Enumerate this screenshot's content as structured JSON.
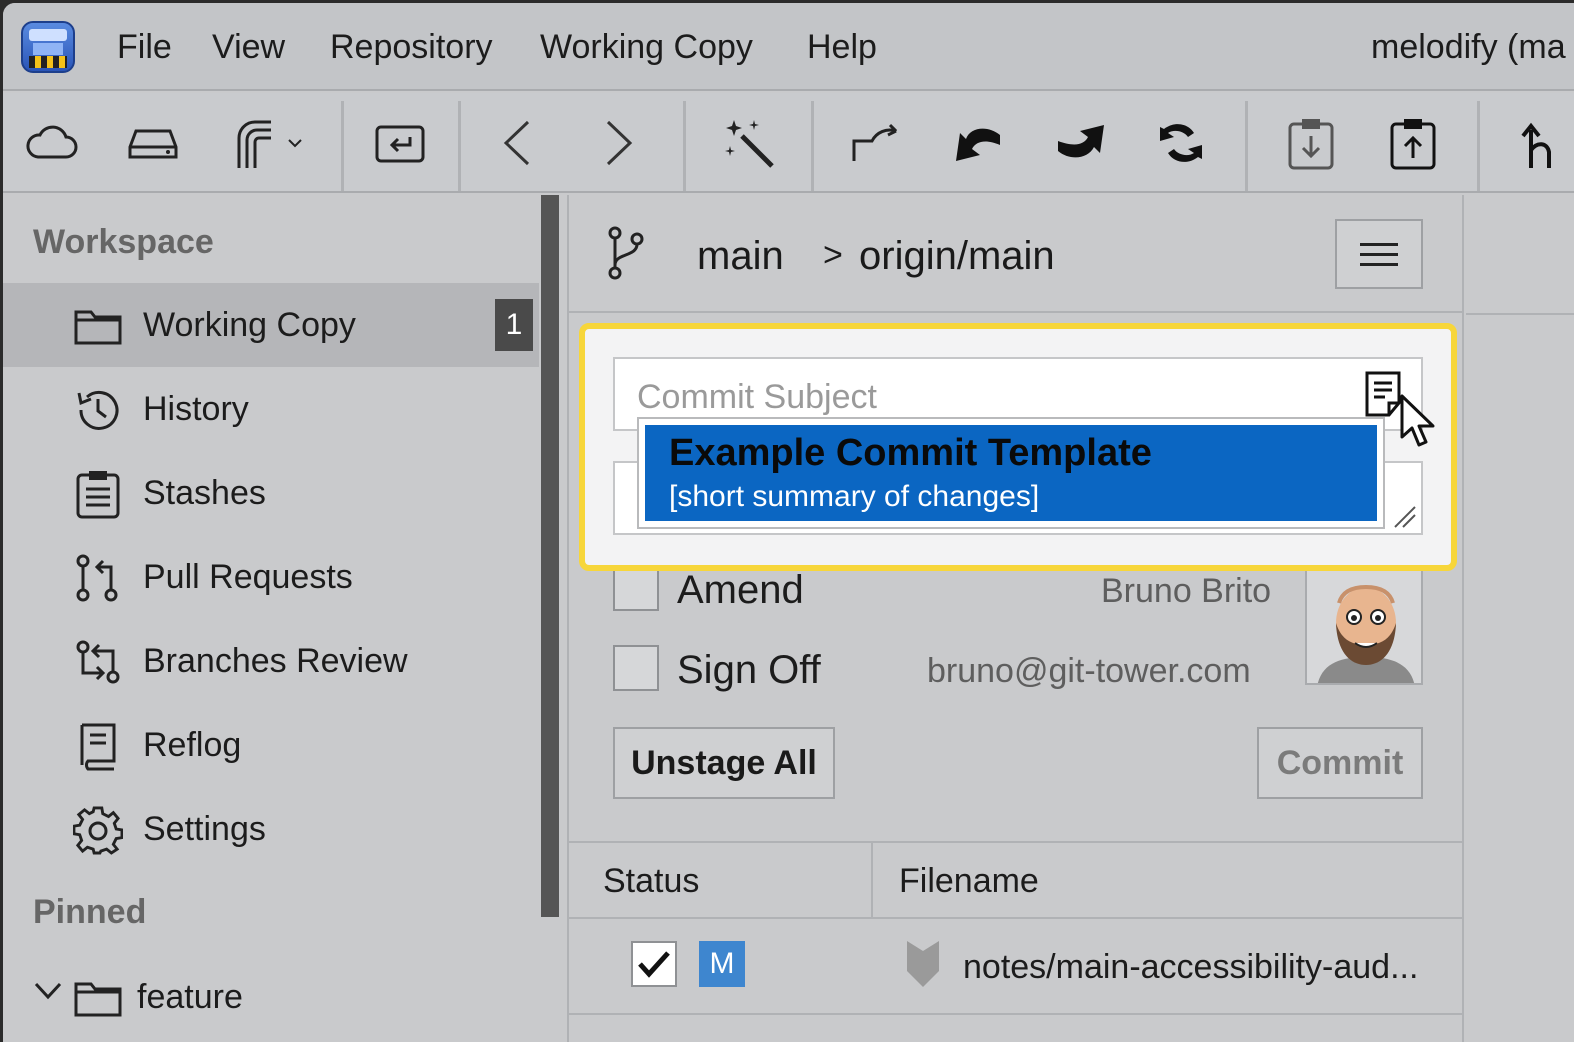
{
  "menubar": {
    "items": [
      "File",
      "View",
      "Repository",
      "Working Copy",
      "Help"
    ],
    "window_title": "melodify (ma"
  },
  "sidebar": {
    "workspace_heading": "Workspace",
    "items": [
      {
        "label": "Working Copy",
        "icon": "folder-icon",
        "badge": "1",
        "selected": true
      },
      {
        "label": "History",
        "icon": "history-icon"
      },
      {
        "label": "Stashes",
        "icon": "stashes-icon"
      },
      {
        "label": "Pull Requests",
        "icon": "pull-request-icon"
      },
      {
        "label": "Branches Review",
        "icon": "branches-review-icon"
      },
      {
        "label": "Reflog",
        "icon": "reflog-icon"
      },
      {
        "label": "Settings",
        "icon": "gear-icon"
      }
    ],
    "pinned_heading": "Pinned",
    "pinned": [
      {
        "label": "feature",
        "icon": "folder-icon"
      }
    ]
  },
  "branch": {
    "local": "main",
    "separator": ">",
    "remote": "origin/main"
  },
  "commit": {
    "subject_placeholder": "Commit Subject",
    "template_title": "Example Commit Template",
    "template_summary": "[short summary of changes]",
    "amend_label": "Amend",
    "signoff_label": "Sign Off",
    "author_name": "Bruno Brito",
    "author_email": "bruno@git-tower.com",
    "unstage_all_label": "Unstage All",
    "commit_label": "Commit"
  },
  "table": {
    "headers": {
      "status": "Status",
      "filename": "Filename"
    },
    "rows": [
      {
        "checked": true,
        "status": "M",
        "filename": "notes/main-accessibility-aud..."
      }
    ]
  },
  "colors": {
    "accent": "#0b66c2",
    "highlight": "#f7d63a",
    "status_modified": "#3e86cf"
  }
}
